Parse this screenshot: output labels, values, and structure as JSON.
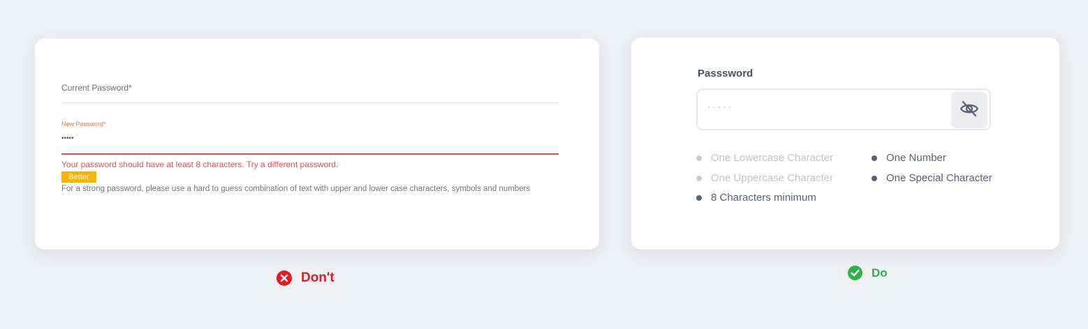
{
  "dont_card": {
    "current_label": "Current Password*",
    "new_label": "New Password*",
    "new_value": "•••••",
    "error_text": "Your password should have at least 8 characters. Try a different password.",
    "strength_badge": "Better",
    "hint_text": "For a strong password, please use a hard to guess combination of text with upper and lower case characters, symbols and numbers"
  },
  "do_card": {
    "label": "Passsword",
    "value": "·····",
    "toggle_icon": "eye-off-icon",
    "requirements": [
      {
        "text": "One Lowercase Character",
        "met": false
      },
      {
        "text": "One Uppercase Character",
        "met": false
      },
      {
        "text": "8 Characters minimum",
        "met": true
      },
      {
        "text": "One Number",
        "met": true
      },
      {
        "text": "One Special Character",
        "met": true
      }
    ]
  },
  "captions": {
    "dont": "Don't",
    "do": "Do"
  },
  "colors": {
    "background": "#eff0f4",
    "error": "#ec4d4d",
    "label_orange": "#f07a3a",
    "badge": "#f8b500",
    "dont_red": "#e21b25",
    "do_green": "#31b14a",
    "requirement_active": "#5a6178",
    "requirement_muted": "#c2c5cd"
  }
}
